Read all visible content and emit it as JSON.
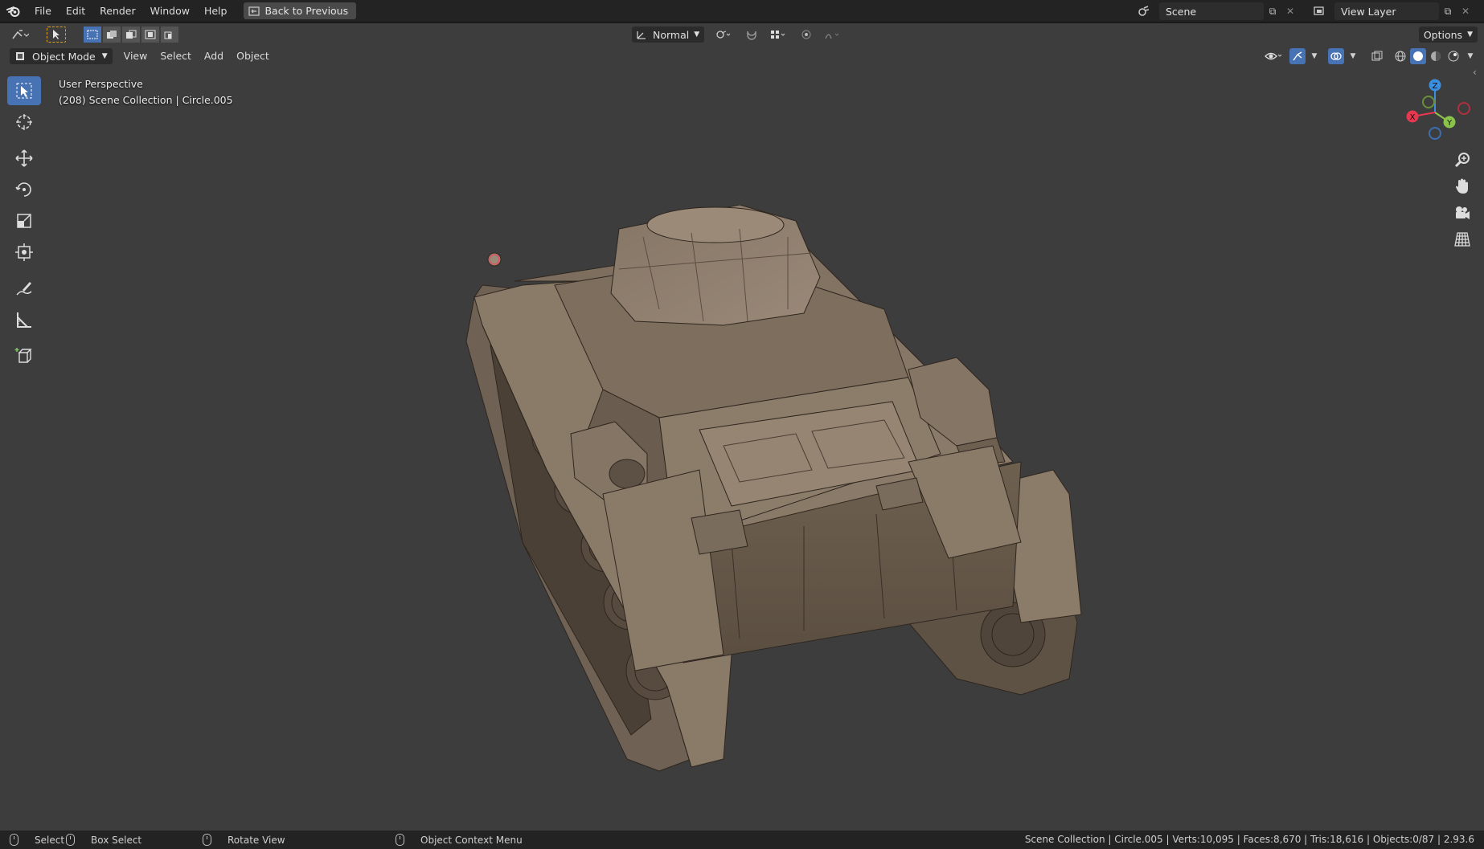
{
  "menu": [
    "File",
    "Edit",
    "Render",
    "Window",
    "Help"
  ],
  "back_button": "Back to Previous",
  "scene": {
    "label": "Scene",
    "view_layer": "View Layer"
  },
  "header": {
    "orientation": "Normal",
    "options": "Options",
    "mode": "Object Mode",
    "menus": [
      "View",
      "Select",
      "Add",
      "Object"
    ]
  },
  "viewport": {
    "perspective": "User Perspective",
    "collection": "(208) Scene Collection | Circle.005"
  },
  "gizmo": {
    "x": "X",
    "y": "Y",
    "z": "Z"
  },
  "statusbar": {
    "select": "Select",
    "box_select": "Box Select",
    "rotate_view": "Rotate View",
    "context_menu": "Object Context Menu",
    "stats": "Scene Collection | Circle.005 | Verts:10,095 | Faces:8,670 | Tris:18,616 | Objects:0/87 | 2.93.6"
  },
  "colors": {
    "accent": "#4772b3",
    "viewport_bg": "#3d3d3d",
    "axis_x": "#e8384f",
    "axis_y": "#8bc34a",
    "axis_z": "#3b8fe0",
    "model": "#8a7a68"
  },
  "icons": [
    "blender-logo-icon",
    "select-box-icon",
    "cursor-icon",
    "move-icon",
    "rotate-icon",
    "scale-icon",
    "transform-icon",
    "annotate-icon",
    "measure-icon",
    "add-cube-icon",
    "zoom-icon",
    "hand-pan-icon",
    "camera-icon",
    "grid-icon"
  ]
}
